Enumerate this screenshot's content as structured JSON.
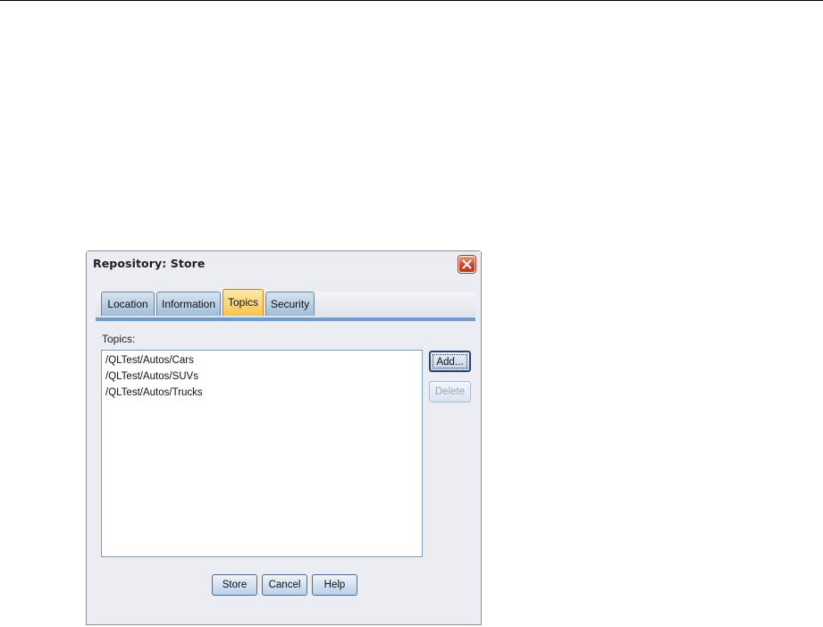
{
  "dialog": {
    "title": "Repository: Store",
    "close_icon": "close-x-icon",
    "tabs": [
      {
        "label": "Location",
        "active": false
      },
      {
        "label": "Information",
        "active": false
      },
      {
        "label": "Topics",
        "active": true
      },
      {
        "label": "Security",
        "active": false
      }
    ],
    "topics_label": "Topics:",
    "topics": [
      "/QLTest/Autos/Cars",
      "/QLTest/Autos/SUVs",
      "/QLTest/Autos/Trucks"
    ],
    "side_buttons": {
      "add": "Add...",
      "delete": "Delete"
    },
    "footer_buttons": {
      "store": "Store",
      "cancel": "Cancel",
      "help": "Help"
    }
  }
}
